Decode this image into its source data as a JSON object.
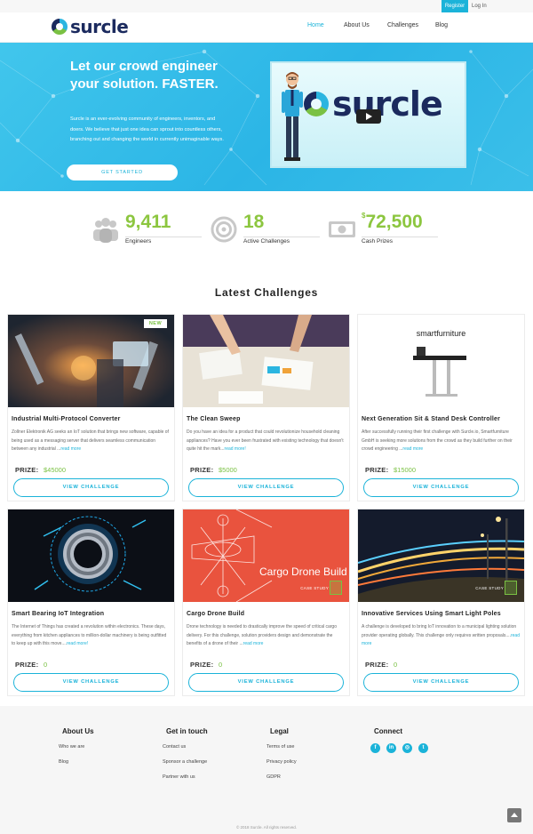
{
  "topbar": {
    "register": "Register",
    "login": "Log In"
  },
  "header": {
    "logo_text": "surcle",
    "nav": [
      "Home",
      "About Us",
      "Challenges",
      "Blog"
    ],
    "active_nav": "Home"
  },
  "hero": {
    "title": "Let our crowd engineer your solution. FASTER.",
    "text": "Surcle is an ever-evolving community of engineers, inventors, and doers. We believe that just one idea can sprout into countless others, branching out and changing the world in currently unimaginable ways.",
    "cta": "GET STARTED",
    "video_brand": "surcle"
  },
  "stats": [
    {
      "icon": "users-icon",
      "currency": "",
      "value": "9,411",
      "label": "Engineers"
    },
    {
      "icon": "target-icon",
      "currency": "",
      "value": "18",
      "label": "Active Challenges"
    },
    {
      "icon": "cash-icon",
      "currency": "$",
      "value": "72,500",
      "label": "Cash Prizes"
    }
  ],
  "latest_title": "Latest Challenges",
  "cards": [
    {
      "title": "Industrial Multi-Protocol Converter",
      "desc": "Zollner Elektronik AG seeks an IoT solution that brings new software, capable of being used as a messaging server that delivers seamless communication between any industrial ...",
      "more": "read more",
      "prize_label": "PRIZE:",
      "prize": "$45000",
      "button": "VIEW CHALLENGE",
      "badge": "NEW"
    },
    {
      "title": "The Clean Sweep",
      "desc": "Do you have an idea for a product that could revolutionize household cleaning appliances? Have you ever been frustrated with existing technology that doesn't quite hit the mark...",
      "more": "read more!",
      "prize_label": "PRIZE:",
      "prize": "$5000",
      "button": "VIEW CHALLENGE"
    },
    {
      "title": "Next Generation Sit & Stand Desk Controller",
      "desc": "After successfully running their first challenge with Surcle.io, Smartfurniture GmbH is seeking more solutions from the crowd as they build further on their crowd engineering ...",
      "more": "read more",
      "prize_label": "PRIZE:",
      "prize": "$15000",
      "button": "VIEW CHALLENGE",
      "image_text": "smartfurniture"
    },
    {
      "title": "Smart Bearing IoT Integration",
      "desc": "The Internet of Things has created a revolution within electronics. These days, everything from kitchen appliances to million-dollar machinery is being outfitted to keep up with this move....",
      "more": "read more!",
      "prize_label": "PRIZE:",
      "prize": "0",
      "button": "VIEW CHALLENGE"
    },
    {
      "title": "Cargo Drone Build",
      "desc": "Drone technology is needed to drastically improve the speed of critical cargo delivery. For this challenge, solution providers design and demonstrate the benefits of a drone of their ...",
      "more": "read more",
      "prize_label": "PRIZE:",
      "prize": "0",
      "button": "VIEW CHALLENGE",
      "image_text": "Cargo Drone Build",
      "case_study": "CASE STUDY"
    },
    {
      "title": "Innovative Services Using Smart Light Poles",
      "desc": "A challenge is developed to bring IoT innovation to a municipal lighting solution provider operating globally. This challenge only requires written proposals....",
      "more": "read more",
      "prize_label": "PRIZE:",
      "prize": "0",
      "button": "VIEW CHALLENGE",
      "case_study": "CASE STUDY"
    }
  ],
  "footer": {
    "about": {
      "heading": "About Us",
      "links": [
        "Who we are",
        "Blog"
      ]
    },
    "contact": {
      "heading": "Get in touch",
      "links": [
        "Contact us",
        "Sponsor a challenge",
        "Partner with us"
      ]
    },
    "legal": {
      "heading": "Legal",
      "links": [
        "Terms of use",
        "Privacy policy",
        "GDPR"
      ]
    },
    "connect": {
      "heading": "Connect",
      "icons": [
        "facebook-icon",
        "linkedin-icon",
        "instagram-icon",
        "twitter-icon"
      ]
    },
    "copyright": "© 2018 Surcle. All rights reserved."
  },
  "colors": {
    "accent": "#1bb3d9",
    "green": "#7ac143",
    "navy": "#1b2a5e"
  }
}
